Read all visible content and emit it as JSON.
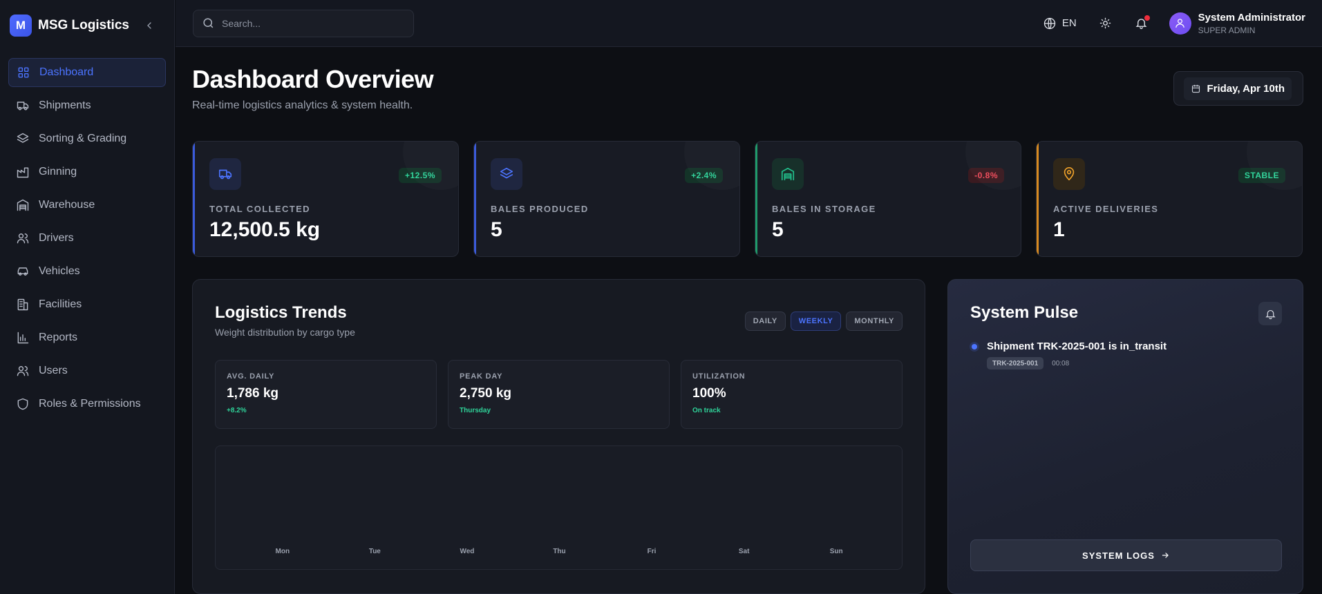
{
  "brand": {
    "name": "MSG Logistics",
    "logo_letter": "M"
  },
  "sidebar": {
    "items": [
      {
        "label": "Dashboard",
        "icon": "grid-icon",
        "active": true
      },
      {
        "label": "Shipments",
        "icon": "truck-icon"
      },
      {
        "label": "Sorting & Grading",
        "icon": "layers-icon"
      },
      {
        "label": "Ginning",
        "icon": "factory-icon"
      },
      {
        "label": "Warehouse",
        "icon": "warehouse-icon"
      },
      {
        "label": "Drivers",
        "icon": "users-icon"
      },
      {
        "label": "Vehicles",
        "icon": "car-icon"
      },
      {
        "label": "Facilities",
        "icon": "building-icon"
      },
      {
        "label": "Reports",
        "icon": "bar-chart-icon"
      },
      {
        "label": "Users",
        "icon": "users-icon"
      },
      {
        "label": "Roles & Permissions",
        "icon": "shield-icon"
      }
    ]
  },
  "topbar": {
    "search_placeholder": "Search...",
    "language": "EN",
    "user_name": "System Administrator",
    "user_role": "SUPER ADMIN"
  },
  "page": {
    "title": "Dashboard Overview",
    "subtitle": "Real-time logistics analytics & system health.",
    "date": "Friday, Apr 10th"
  },
  "stats": [
    {
      "label": "TOTAL COLLECTED",
      "value": "12,500.5 kg",
      "badge": "+12.5%",
      "tone": "blue",
      "badge_tone": "green",
      "icon": "truck-icon"
    },
    {
      "label": "BALES PRODUCED",
      "value": "5",
      "badge": "+2.4%",
      "tone": "blue",
      "badge_tone": "green",
      "icon": "layers-icon"
    },
    {
      "label": "BALES IN STORAGE",
      "value": "5",
      "badge": "-0.8%",
      "tone": "green",
      "badge_tone": "red",
      "icon": "warehouse-icon"
    },
    {
      "label": "ACTIVE DELIVERIES",
      "value": "1",
      "badge": "STABLE",
      "tone": "orange",
      "badge_tone": "green",
      "icon": "map-pin-icon"
    }
  ],
  "trends": {
    "title": "Logistics Trends",
    "subtitle": "Weight distribution by cargo type",
    "toggles": [
      "DAILY",
      "WEEKLY",
      "MONTHLY"
    ],
    "active_toggle": "WEEKLY",
    "metrics": [
      {
        "label": "AVG. DAILY",
        "value": "1,786 kg",
        "note": "+8.2%"
      },
      {
        "label": "PEAK DAY",
        "value": "2,750 kg",
        "note": "Thursday"
      },
      {
        "label": "UTILIZATION",
        "value": "100%",
        "note": "On track"
      }
    ]
  },
  "chart_data": {
    "type": "bar",
    "categories": [
      "Mon",
      "Tue",
      "Wed",
      "Thu",
      "Fri",
      "Sat",
      "Sun"
    ],
    "values": [
      0,
      0,
      0,
      0,
      0,
      0,
      0
    ],
    "title": "",
    "xlabel": "",
    "ylabel": "",
    "grid": false
  },
  "pulse": {
    "title": "System Pulse",
    "events": [
      {
        "title": "Shipment TRK-2025-001 is in_transit",
        "tag": "TRK-2025-001",
        "time": "00:08"
      }
    ],
    "logs_label": "SYSTEM LOGS"
  },
  "colors": {
    "accent": "#4c74ff",
    "success": "#2fd49a",
    "danger": "#ef4a5a",
    "warning": "#f0a22a",
    "background": "#0d0f14"
  }
}
